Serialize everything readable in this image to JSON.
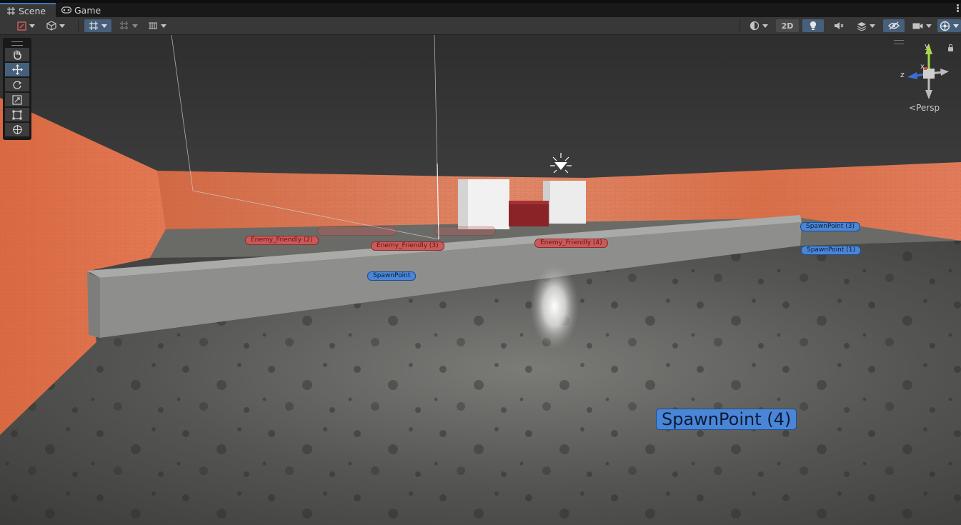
{
  "tabs": [
    {
      "label": "Scene",
      "icon": "grid-icon",
      "active": true
    },
    {
      "label": "Game",
      "icon": "gamepad-icon",
      "active": false
    }
  ],
  "toolbar": {
    "mode_2d_label": "2D"
  },
  "tools": [
    "hand-tool",
    "move-tool",
    "rotate-tool",
    "scale-tool",
    "rect-tool",
    "transform-tool"
  ],
  "scene_labels": {
    "enemy_friendly_2": "Enemy_Friendly (2)",
    "enemy_friendly_3": "Enemy_Friendly (3)",
    "enemy_friendly_4": "Enemy_Friendly (4)",
    "spawn_point": "SpawnPoint",
    "spawn_point_1": "SpawnPoint (1)",
    "spawn_point_3": "SpawnPoint (3)",
    "spawn_point_4": "SpawnPoint (4)"
  },
  "gizmo": {
    "axis_x": "x",
    "axis_y": "y",
    "axis_z": "z",
    "projection_label": "Persp"
  },
  "colors": {
    "selection_blue": "#46607c",
    "wall_orange": "#d9673f",
    "spawn_label": "#4a86d8",
    "enemy_label": "#c95a5a"
  }
}
